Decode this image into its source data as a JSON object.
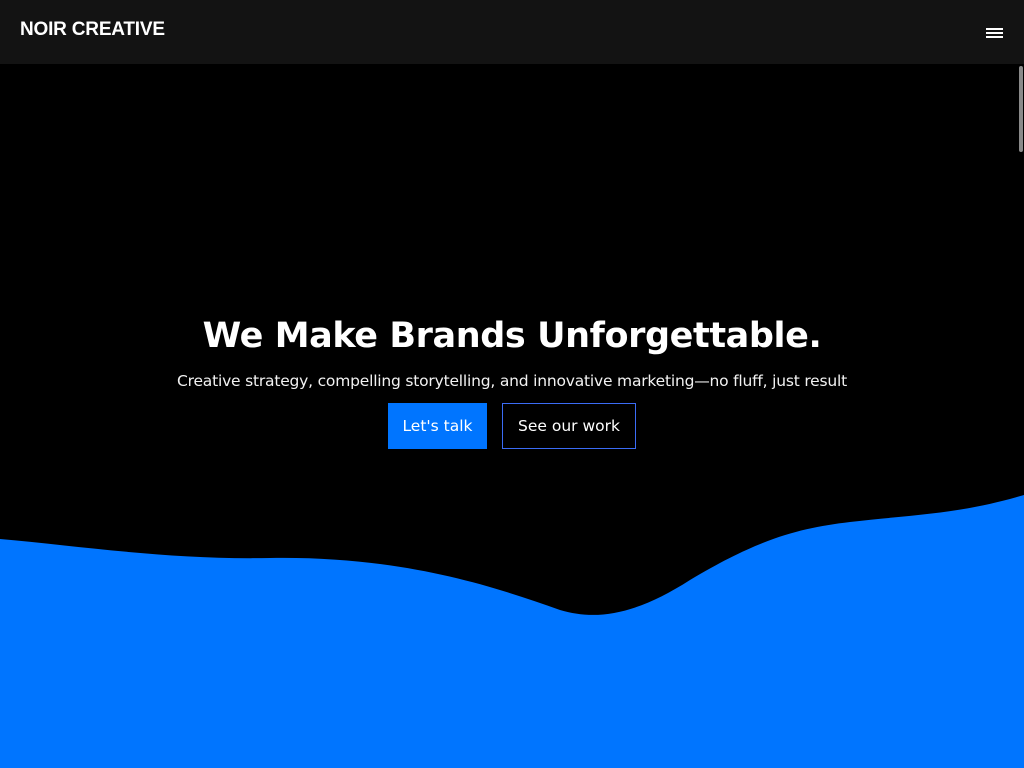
{
  "header": {
    "brand": "NOIR CREATIVE",
    "menu_icon": "hamburger-menu-icon"
  },
  "hero": {
    "title": "We Make Brands Unforgettable.",
    "subtitle": "Creative strategy, compelling storytelling, and innovative marketing—no fluff, just result",
    "primary_button": "Let's talk",
    "secondary_button": "See our work"
  },
  "colors": {
    "background": "#000000",
    "navbar": "#131313",
    "accent": "#0075ff",
    "outline_border": "#3b6cf5",
    "text": "#ffffff"
  }
}
